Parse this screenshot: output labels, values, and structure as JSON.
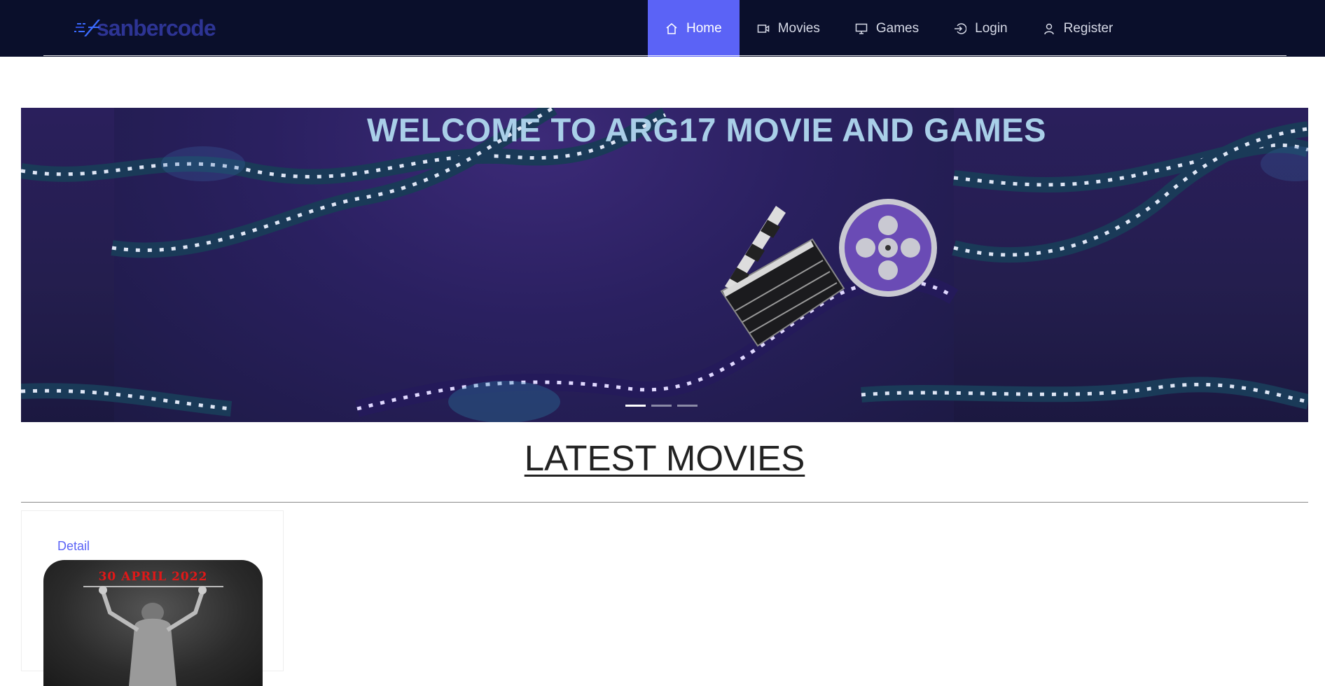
{
  "brand": {
    "name": "sanbercode"
  },
  "nav": {
    "items": [
      {
        "label": "Home",
        "icon": "home-icon",
        "active": true
      },
      {
        "label": "Movies",
        "icon": "video-camera-icon",
        "active": false
      },
      {
        "label": "Games",
        "icon": "monitor-icon",
        "active": false
      },
      {
        "label": "Login",
        "icon": "login-icon",
        "active": false
      },
      {
        "label": "Register",
        "icon": "user-icon",
        "active": false
      }
    ]
  },
  "hero": {
    "title": "WELCOME TO ARG17 MOVIE AND GAMES",
    "slides": 3,
    "active_slide": 1
  },
  "latest": {
    "title": "LATEST MOVIES",
    "cards": [
      {
        "link_label": "Detail",
        "poster_date": "30 APRIL 2022"
      }
    ]
  },
  "colors": {
    "navbar": "#0a0f2b",
    "accent": "#5b63f6",
    "hero_title": "#a9cfe8"
  }
}
